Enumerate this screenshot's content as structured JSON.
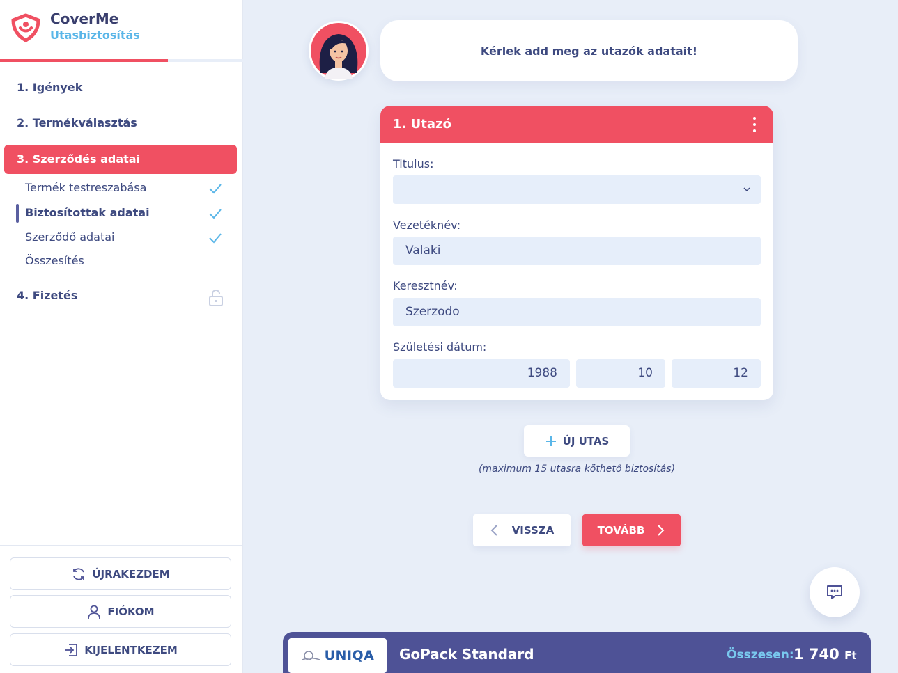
{
  "brand": {
    "name": "CoverMe",
    "subtitle": "Utasbiztosítás"
  },
  "progress": {
    "fraction": 0.69
  },
  "steps": [
    {
      "label": "1. Igények"
    },
    {
      "label": "2. Termékválasztás"
    },
    {
      "label": "3. Szerződés adatai",
      "active": true
    },
    {
      "label": "4. Fizetés",
      "locked": true
    }
  ],
  "substeps": [
    {
      "label": "Termék testreszabása",
      "done": true
    },
    {
      "label": "Biztosítottak adatai",
      "done": true,
      "current": true
    },
    {
      "label": "Szerződő adatai",
      "done": true
    },
    {
      "label": "Összesítés",
      "done": false
    }
  ],
  "sidebar_buttons": {
    "restart": "ÚJRAKEZDEM",
    "account": "FIÓKOM",
    "logout": "KIJELENTKEZEM"
  },
  "assistant": {
    "message": "Kérlek add meg az utazók adatait!"
  },
  "traveler_card": {
    "title": "1. Utazó",
    "title_label": "Titulus:",
    "title_value": "",
    "lastname_label": "Vezetéknév:",
    "lastname_value": "Valaki",
    "firstname_label": "Keresztnév:",
    "firstname_value": "Szerzodo",
    "birthdate_label": "Születési dátum:",
    "birth_year": "1988",
    "birth_month": "10",
    "birth_day": "12"
  },
  "new_traveler": {
    "label": "ÚJ UTAS",
    "hint": "(maximum 15 utasra köthető biztosítás)"
  },
  "nav": {
    "back": "VISSZA",
    "next": "TOVÁBB"
  },
  "footer": {
    "insurer": "UNIQA",
    "product": "GoPack Standard",
    "total_label": "Összesen:",
    "total_value": "1 740",
    "currency": "Ft"
  },
  "colors": {
    "accent": "#f05062",
    "primary": "#4e5296",
    "secondary": "#5ab6e8",
    "background": "#e8eef8"
  }
}
